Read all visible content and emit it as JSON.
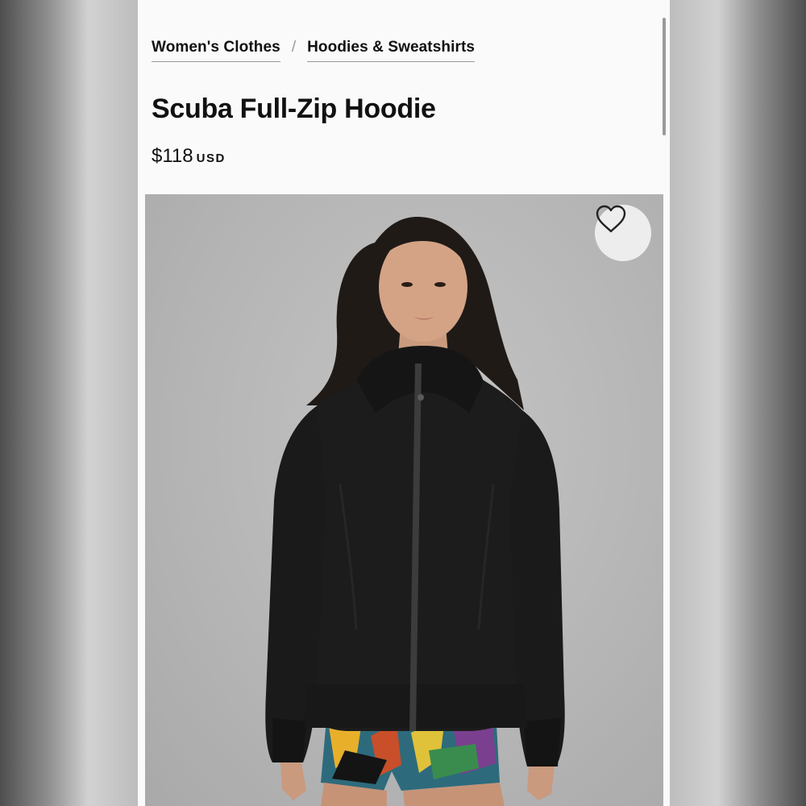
{
  "breadcrumb": {
    "items": [
      {
        "label": "Women's Clothes"
      },
      {
        "label": "Hoodies & Sweatshirts"
      }
    ],
    "separator": "/"
  },
  "product": {
    "title": "Scuba Full-Zip Hoodie",
    "price": "$118",
    "currency": "USD",
    "image_alt": "Model wearing black full-zip hoodie with colorful printed shorts"
  },
  "icons": {
    "wishlist": "heart-icon"
  },
  "colors": {
    "text": "#111111",
    "page_background": "#fafafa",
    "image_background": "#b8b8b8",
    "garment": "#1c1c1c"
  }
}
